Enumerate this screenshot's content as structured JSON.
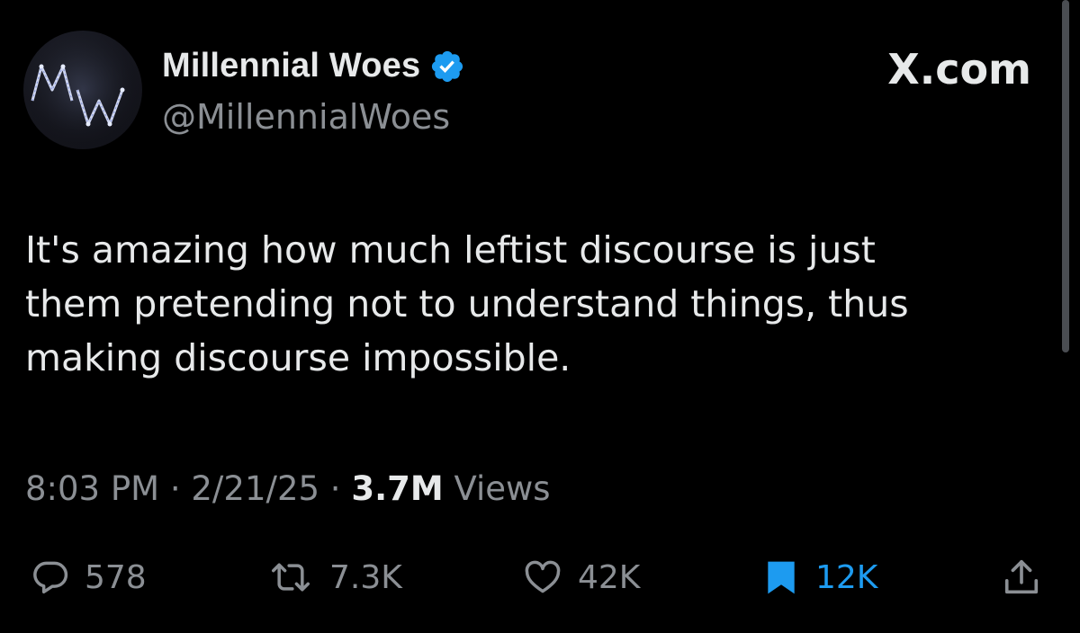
{
  "author": {
    "avatar_text": "MW",
    "display_name": "Millennial Woes",
    "handle": "@MillennialWoes",
    "verified_icon": "verified-badge-icon",
    "verified_color": "#1d9bf0"
  },
  "site_label": "X.com",
  "tweet": {
    "lines": [
      "It's amazing how much leftist discourse is just",
      "them pretending not to understand things, thus",
      "making discourse impossible."
    ]
  },
  "meta": {
    "time": "8:03 PM",
    "separator": "·",
    "date": "2/21/25",
    "views_count": "3.7M",
    "views_label": "Views"
  },
  "actions": {
    "reply": {
      "icon": "reply-icon",
      "count": "578"
    },
    "repost": {
      "icon": "repost-icon",
      "count": "7.3K"
    },
    "like": {
      "icon": "heart-icon",
      "count": "42K"
    },
    "bookmark": {
      "icon": "bookmark-icon",
      "count": "12K",
      "active_color": "#1d9bf0"
    },
    "share": {
      "icon": "share-icon"
    }
  },
  "colors": {
    "background": "#000000",
    "text_primary": "#e7e9ea",
    "text_secondary": "#8b8f94",
    "accent": "#1d9bf0"
  }
}
